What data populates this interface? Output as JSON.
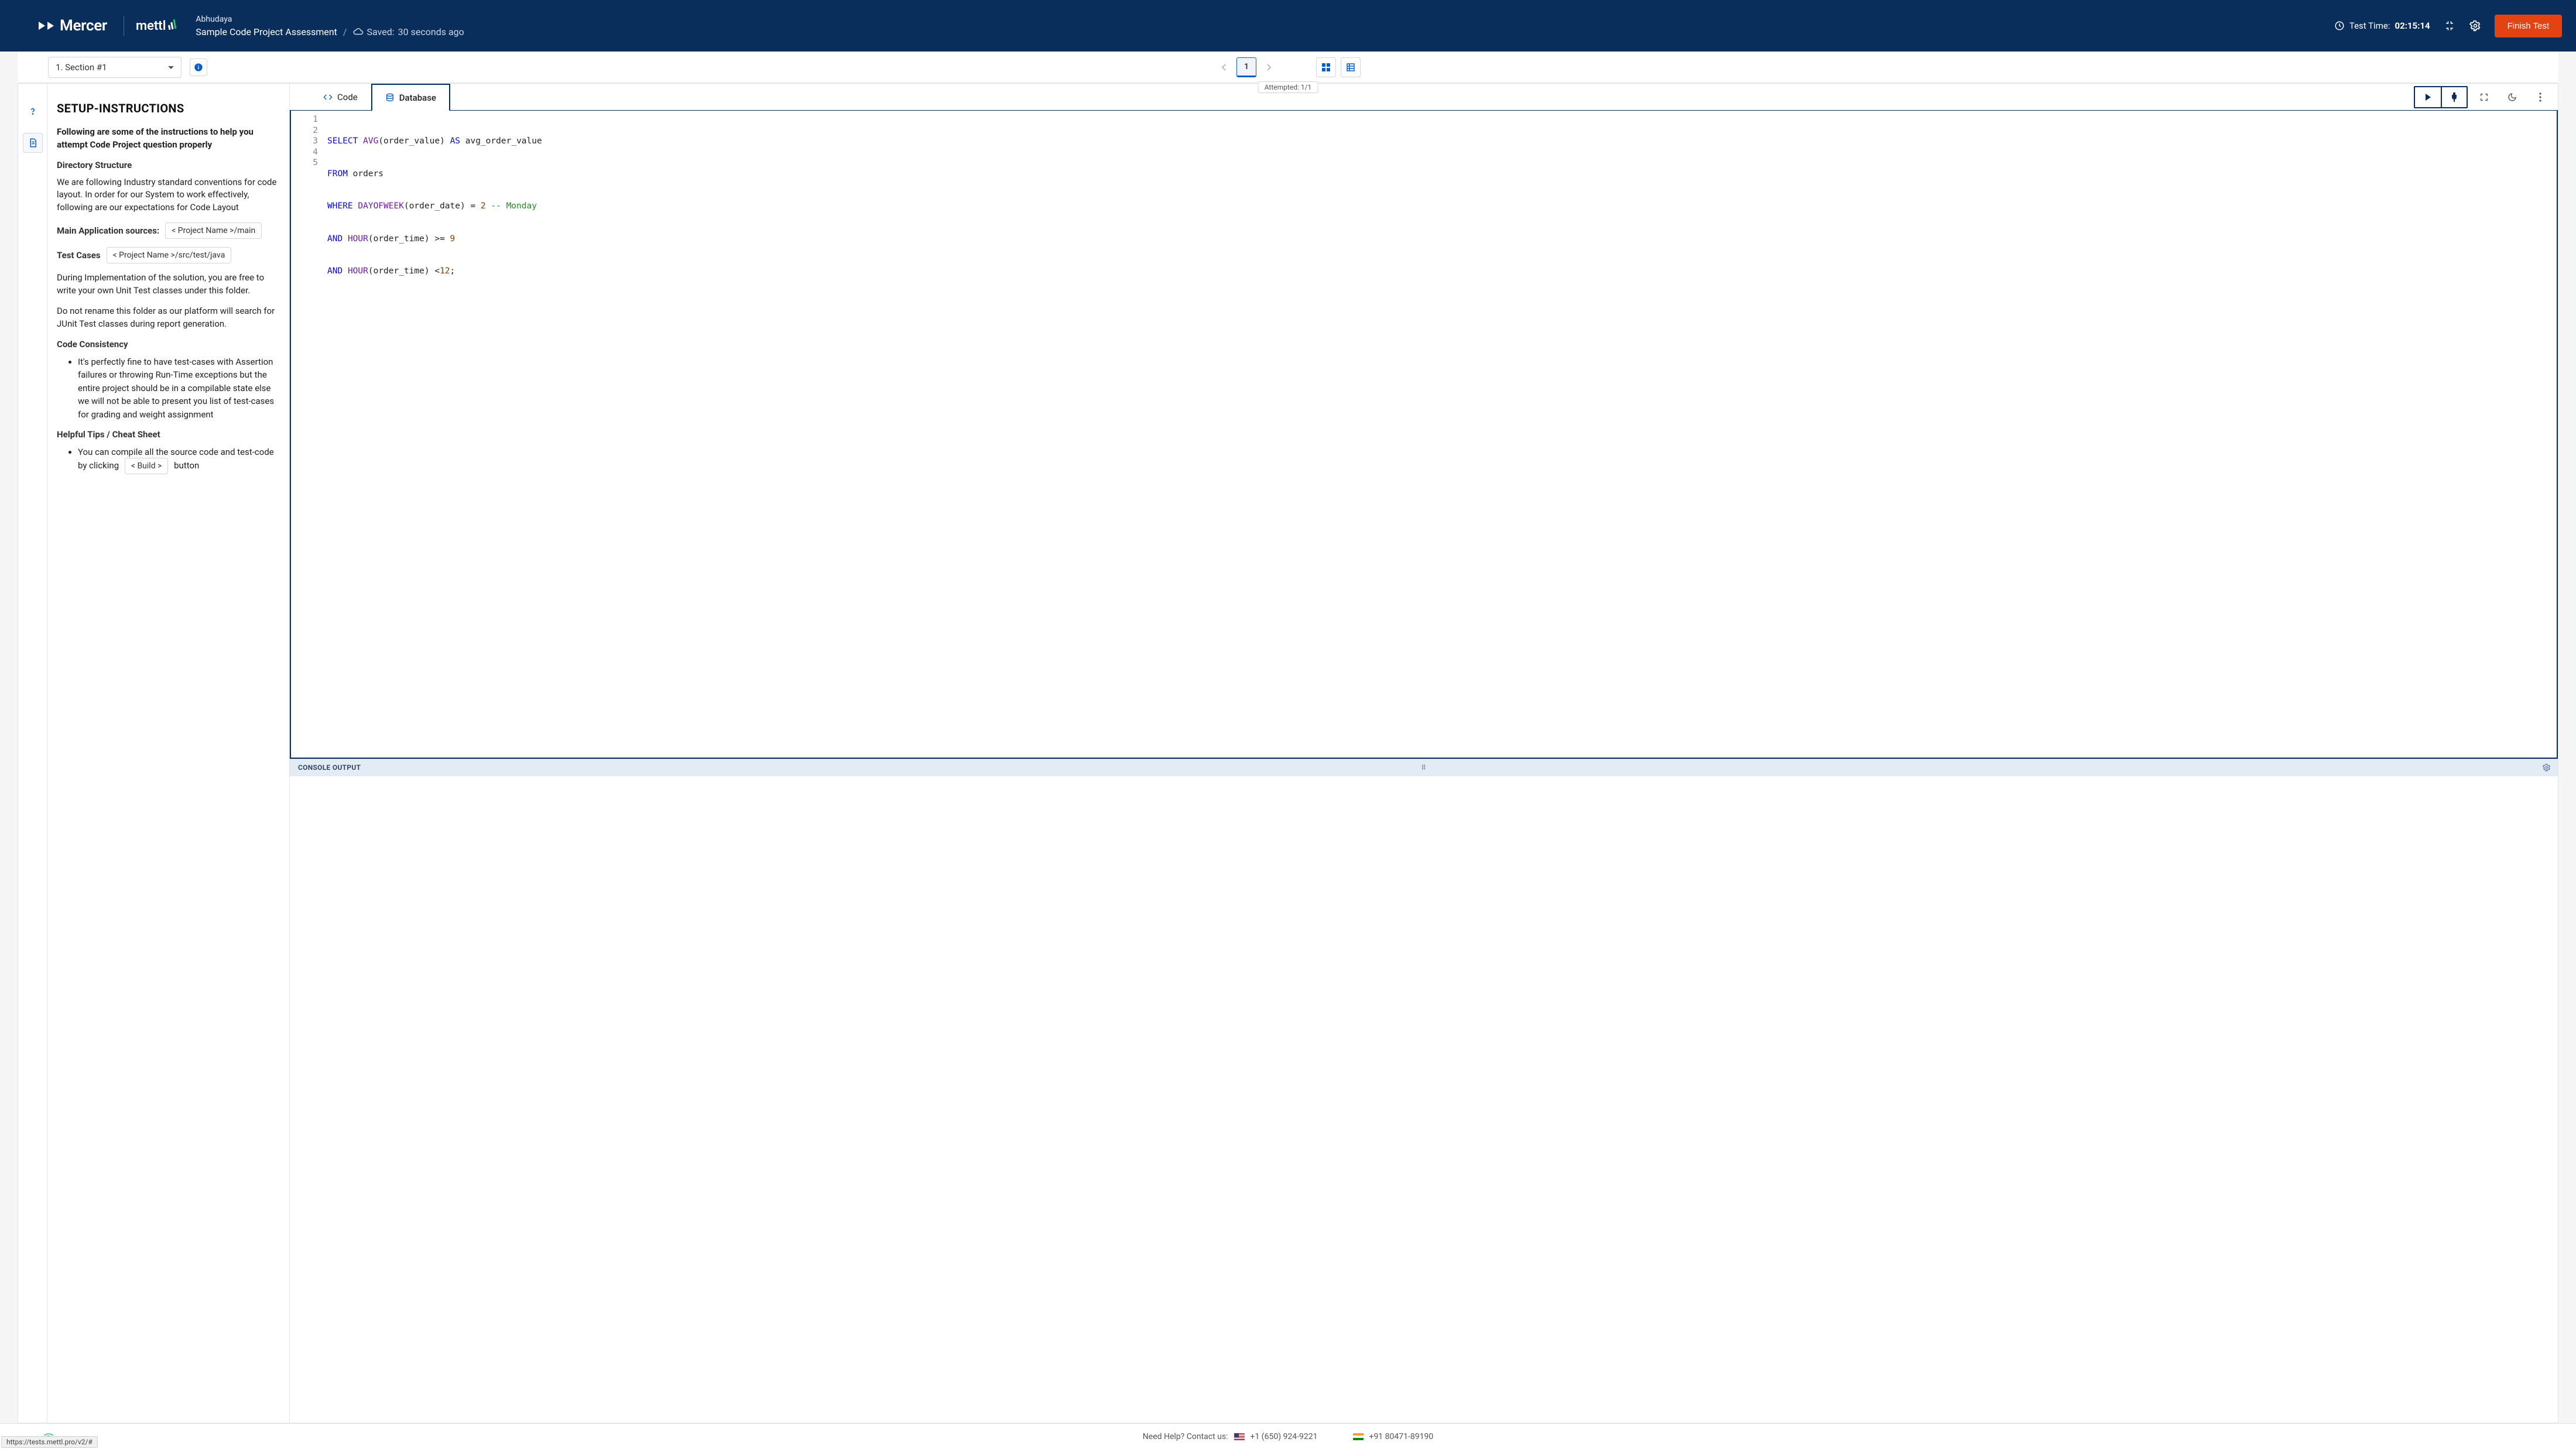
{
  "header": {
    "brand_left": "Mercer",
    "brand_right": "mettl",
    "user": "Abhudaya",
    "assessment": "Sample Code Project Assessment",
    "saved_prefix": "Saved:",
    "saved_text": "30 seconds ago",
    "test_time_label": "Test Time:",
    "test_time_value": "02:15:14",
    "finish_label": "Finish Test"
  },
  "subbar": {
    "section_label": "1. Section #1",
    "question_number": "1",
    "attempted": "Attempted: 1/1"
  },
  "instructions": {
    "title": "SETUP-INSTRUCTIONS",
    "intro": "Following are some of the instructions to help you attempt Code Project question properly",
    "dir_h": "Directory Structure",
    "dir_p": "We are following Industry standard conventions for code layout. In order for our System to work effectively, following are our expectations for Code Layout",
    "main_src_label": "Main Application sources:",
    "main_src_path": "< Project Name >/main",
    "test_label": "Test Cases",
    "test_path": "< Project Name >/src/test/java",
    "impl_p": "During Implementation of the solution, you are free to write your own Unit Test classes under this folder.",
    "rename_p": "Do not rename this folder as our platform will search for JUnit Test classes during report generation.",
    "cc_h": "Code Consistency",
    "cc_li": "It's perfectly fine to have test-cases with Assertion failures or throwing Run-Time exceptions but the entire project should be in a compilable state else we will not be able to present you list of test-cases for grading and weight assignment",
    "tips_h": "Helpful Tips / Cheat Sheet",
    "tips_li_pre": "You can compile all the source code and test-code by clicking",
    "tips_build": "< Build >",
    "tips_li_post": "button"
  },
  "editor": {
    "tab_code": "Code",
    "tab_db": "Database",
    "console": "CONSOLE OUTPUT",
    "lines": [
      "1",
      "2",
      "3",
      "4",
      "5"
    ],
    "code": {
      "l1_a": "SELECT",
      "l1_b": "AVG",
      "l1_c": "(order_value)",
      "l1_d": "AS",
      "l1_e": "avg_order_value",
      "l2_a": "FROM",
      "l2_b": "orders",
      "l3_a": "WHERE",
      "l3_b": "DAYOFWEEK",
      "l3_c": "(order_date) =",
      "l3_d": "2",
      "l3_e": "-- Monday",
      "l4_a": "AND",
      "l4_b": "HOUR",
      "l4_c": "(order_time) >=",
      "l4_d": "9",
      "l5_a": "AND",
      "l5_b": "HOUR",
      "l5_c": "(order_time) <",
      "l5_d": "12",
      "l5_e": ";"
    }
  },
  "footer": {
    "help": "Need Help? Contact us:",
    "us_phone": "+1 (650) 924-9221",
    "in_phone": "+91 80471-89190",
    "status_url": "https://tests.mettl.pro/v2/#"
  }
}
